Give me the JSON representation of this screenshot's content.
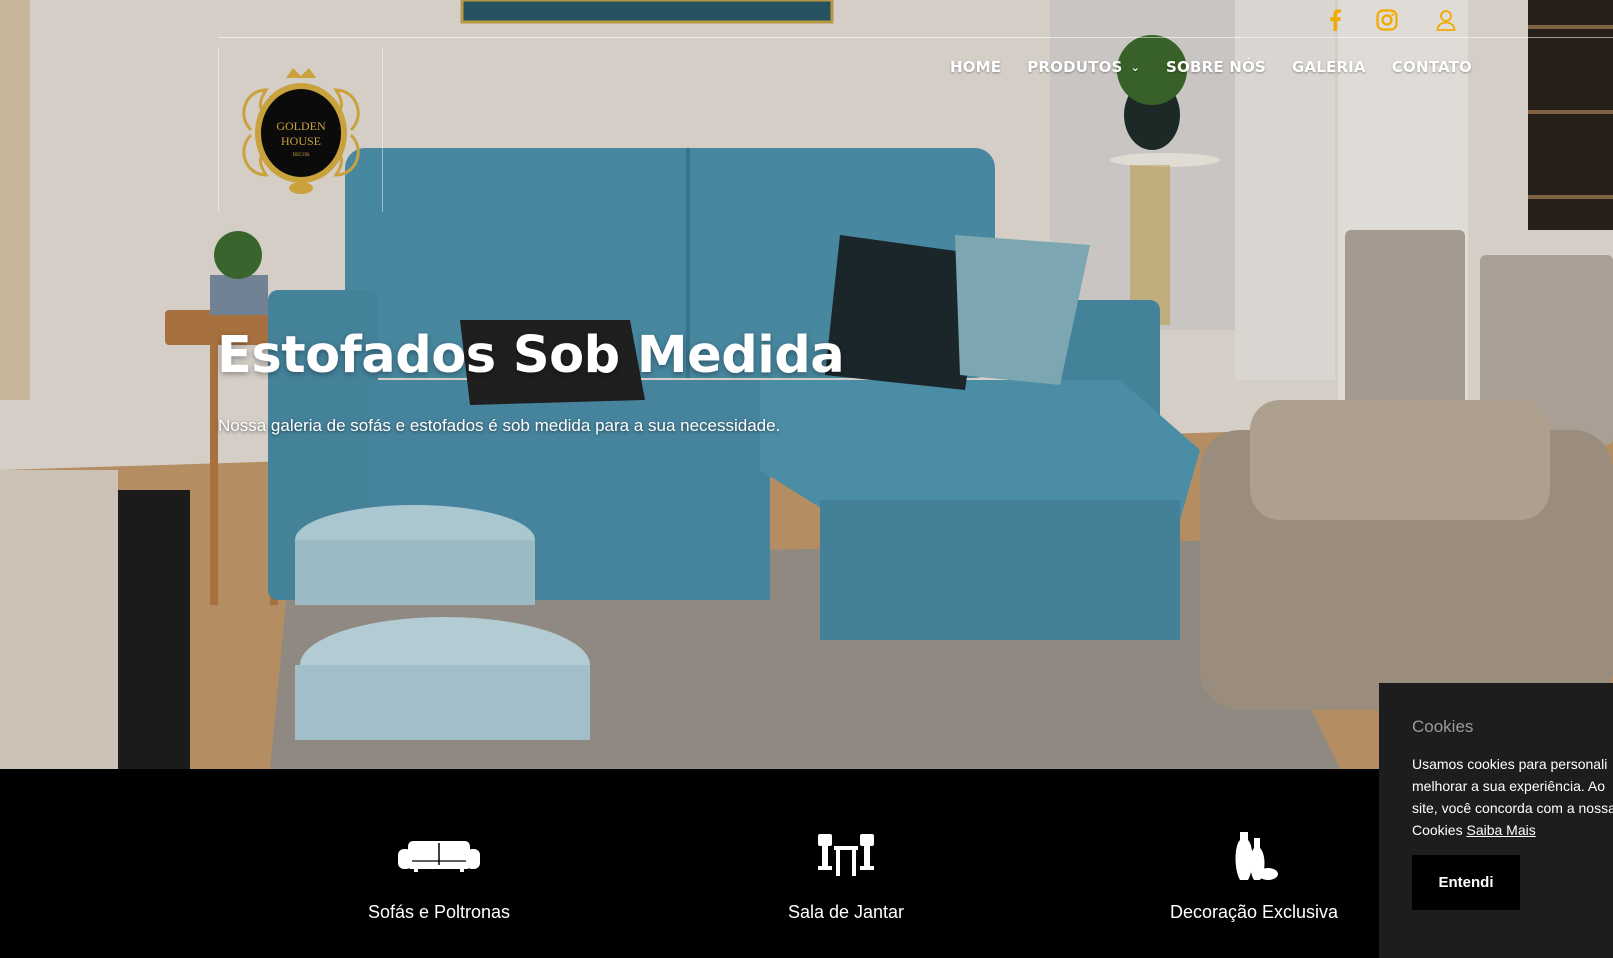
{
  "brand": {
    "logo_line1": "GOLDEN",
    "logo_line2": "HOUSE",
    "logo_line3": "DECOR"
  },
  "header": {
    "social": [
      {
        "icon": "facebook-icon",
        "color": "#f2a900"
      },
      {
        "icon": "instagram-icon",
        "color": "#f2a900"
      },
      {
        "icon": "user-icon",
        "color": "#f2a900"
      }
    ],
    "nav": [
      {
        "label": "HOME"
      },
      {
        "label": "PRODUTOS",
        "has_dropdown": true
      },
      {
        "label": "SOBRE NÓS"
      },
      {
        "label": "GALERIA"
      },
      {
        "label": "CONTATO"
      }
    ]
  },
  "hero": {
    "title": "Estofados Sob Medida",
    "subtitle": "Nossa galeria de sofás e estofados é sob medida para a sua necessidade."
  },
  "categories": [
    {
      "label": "Sofás e Poltronas",
      "icon": "sofa-icon"
    },
    {
      "label": "Sala de Jantar",
      "icon": "dining-table-icon"
    },
    {
      "label": "Decoração Exclusiva",
      "icon": "vases-icon"
    }
  ],
  "cookies": {
    "title": "Cookies",
    "line1": "Usamos cookies para personali",
    "line2": "melhorar a sua experiência. Ao",
    "line3": "site, você concorda com a nossa",
    "line4": "Cookies",
    "more_label": "Saiba Mais",
    "button_label": "Entendi"
  },
  "colors": {
    "accent": "#f2a900",
    "footer_bg": "#000000",
    "cookie_bg": "#1d1d1d"
  }
}
